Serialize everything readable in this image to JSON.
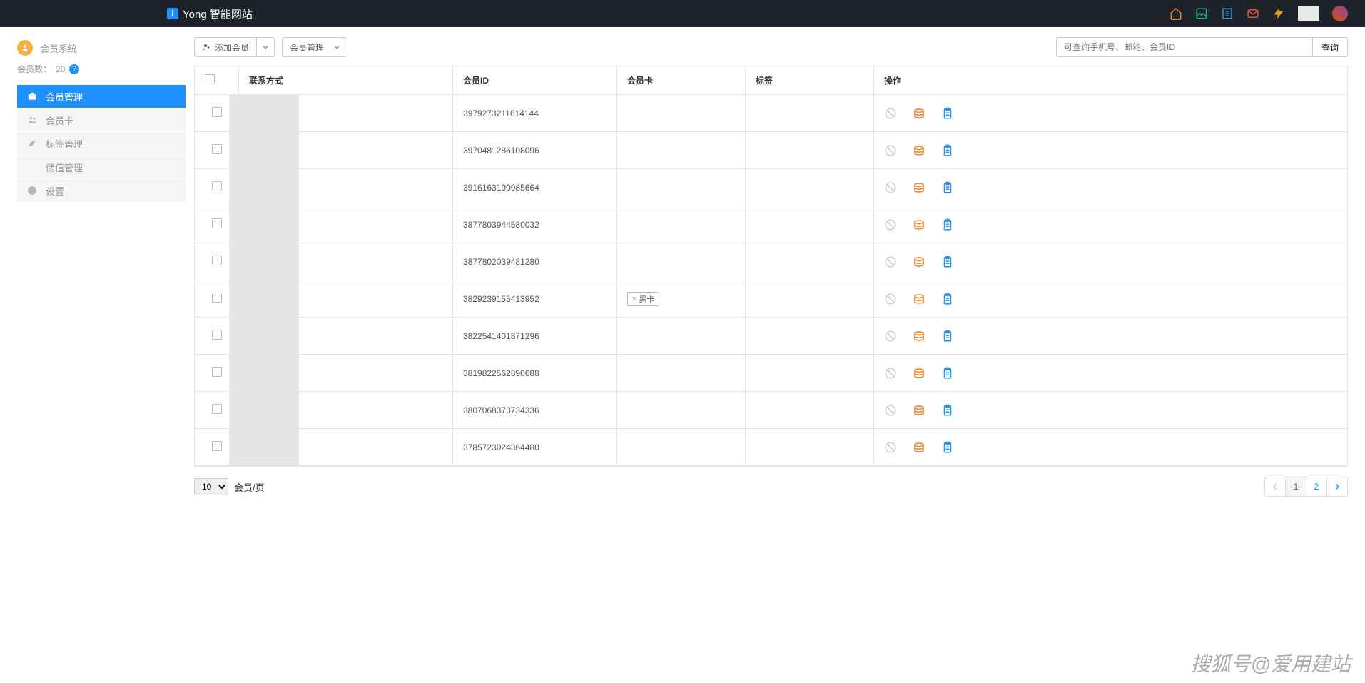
{
  "brand": {
    "badge": "i",
    "name": "Yong 智能网站"
  },
  "sidebar": {
    "title": "会员系统",
    "member_count_label": "会员数：",
    "member_count": "20",
    "items": [
      {
        "label": "会员管理",
        "active": true
      },
      {
        "label": "会员卡",
        "active": false
      },
      {
        "label": "标签管理",
        "active": false
      },
      {
        "label": "储值管理",
        "active": false
      },
      {
        "label": "设置",
        "active": false
      }
    ]
  },
  "toolbar": {
    "add_member": "添加会员",
    "member_mgmt": "会员管理",
    "search_placeholder": "可查询手机号、邮箱、会员ID",
    "search_btn": "查询"
  },
  "columns": {
    "contact": "联系方式",
    "member_id": "会员ID",
    "card": "会员卡",
    "tag": "标签",
    "ops": "操作"
  },
  "rows": [
    {
      "id": "3979273211614144",
      "tag": ""
    },
    {
      "id": "3970481286108096",
      "tag": ""
    },
    {
      "id": "3916163190985664",
      "tag": ""
    },
    {
      "id": "3877803944580032",
      "tag": ""
    },
    {
      "id": "3877802039481280",
      "tag": ""
    },
    {
      "id": "3829239155413952",
      "tag": "黑卡"
    },
    {
      "id": "3822541401871296",
      "tag": ""
    },
    {
      "id": "3819822562890688",
      "tag": ""
    },
    {
      "id": "3807068373734336",
      "tag": ""
    },
    {
      "id": "3785723024364480",
      "tag": ""
    }
  ],
  "footer": {
    "page_size_options": [
      "10"
    ],
    "page_size_suffix": "会员/页",
    "pages": [
      "1",
      "2"
    ],
    "active_page": "1"
  },
  "watermark": "搜狐号@爱用建站"
}
